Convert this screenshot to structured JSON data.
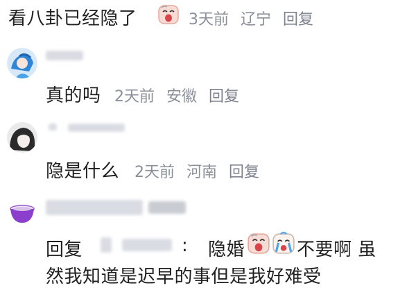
{
  "top_comment": {
    "text": "看八卦已经隐了",
    "time": "3天前",
    "location": "辽宁",
    "reply": "回复",
    "emoji": "crying-face-icon"
  },
  "comments": [
    {
      "text": "真的吗",
      "time": "2天前",
      "location": "安徽",
      "reply": "回复",
      "avatar": "blue-girl-avatar"
    },
    {
      "text": "隐是什么",
      "time": "2天前",
      "location": "河南",
      "reply": "回复",
      "avatar": "dark-hair-avatar"
    },
    {
      "reply_prefix": "回复",
      "reply_suffix": ":",
      "text_a": "隐婚",
      "text_b": "不要啊 虽",
      "text_line2": "然我知道是迟早的事但是我好难受",
      "avatar": "purple-bowl-avatar",
      "emojis": [
        "crying-face-icon",
        "crying-tears-icon"
      ]
    }
  ]
}
